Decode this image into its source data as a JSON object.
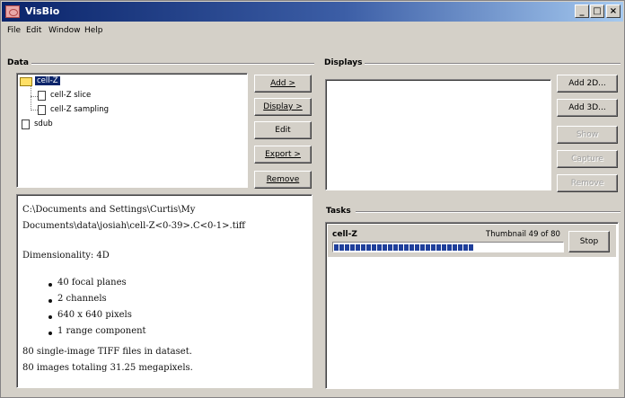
{
  "window": {
    "title": "VisBio",
    "minimize": "_",
    "maximize": "□",
    "close": "×"
  },
  "menu": [
    "File",
    "Edit",
    "Window",
    "Help"
  ],
  "data_section": {
    "label": "Data",
    "tree": [
      {
        "label": "cell-Z",
        "selected": true,
        "icon": "folder-open-icon"
      },
      {
        "label": "cell-Z slice",
        "icon": "document-icon"
      },
      {
        "label": "cell-Z sampling",
        "icon": "document-icon"
      },
      {
        "label": "sdub",
        "icon": "document-icon"
      }
    ],
    "buttons": [
      "Add >",
      "Display >",
      "Edit",
      "Export >",
      "Remove"
    ]
  },
  "info": {
    "path_line1": "C:\\Documents and Settings\\Curtis\\My",
    "path_line2": "Documents\\data\\josiah\\cell-Z<0-39>.C<0-1>.tiff",
    "dimensionality": "Dimensionality: 4D",
    "bullets": [
      "40 focal planes",
      "2 channels",
      "640 x 640 pixels",
      "1 range component"
    ],
    "summary1": "80 single-image TIFF files in dataset.",
    "summary2": "80 images totaling 31.25 megapixels."
  },
  "displays_section": {
    "label": "Displays",
    "buttons": [
      {
        "label": "Add 2D...",
        "enabled": true
      },
      {
        "label": "Add 3D...",
        "enabled": true
      },
      {
        "label": "Show",
        "enabled": false
      },
      {
        "label": "Capture",
        "enabled": false
      },
      {
        "label": "Remove",
        "enabled": false
      }
    ]
  },
  "tasks_section": {
    "label": "Tasks",
    "task": {
      "name": "cell-Z",
      "status": "Thumbnail 49 of 80",
      "progress": 0.61,
      "stop_label": "Stop"
    }
  },
  "colors": {
    "titlebar_start": "#0a246a",
    "titlebar_end": "#a6caf0",
    "progress": "#1f3f9b",
    "face": "#d4d0c8"
  }
}
